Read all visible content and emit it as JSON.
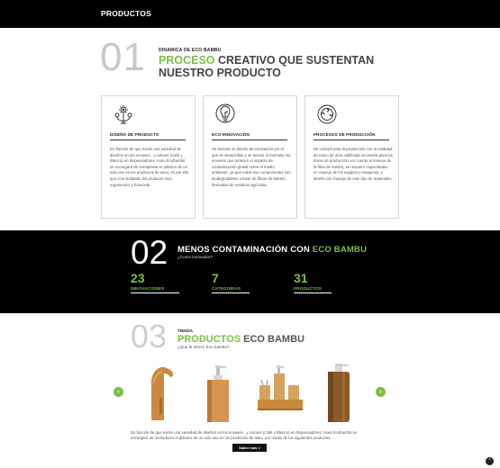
{
  "header": {
    "title": "PRODUCTOS"
  },
  "section1": {
    "number": "01",
    "eyebrow": "DINAMICA DE ECO BAMBU",
    "heading_green": "PROCESO",
    "heading_rest": " CREATIVO QUE SUSTENTAN NUESTRO PRODUCTO",
    "cards": [
      {
        "icon": "gear-tree-icon",
        "title": "DISEÑO DE PRODUCTO",
        "body": "En función de que existe una variedad de diseños en los envases , y colores (Café y Blanco) en dispensadores, Aseo Ecobambú se encargará de reemplazar el plástico de un solo uso en los productos de aseo, es por ello que el prototipado del producto sera ergonomico y funcional."
      },
      {
        "icon": "lightbulb-leaf-icon",
        "title": "ECO-INNOVACIÓN",
        "body": "Se lanzará un diseño de innovación por el que se desarrollan y se lanzan al mercado los envases que reducen el impacto de contaminación global sobre el medio ambiente, ya que todos sus componentes son biodegradables a base de fibras de bambú, derivados de residuos agrícolas."
      },
      {
        "icon": "recycle-icon",
        "title": "PROCESOS DE PRODUCCIÓN",
        "body": "Se contará para la producción con la cantidad de mano de obra calificada necesaria para las áreas de producción, en cuanto al manejo de la fibra de bambú, se requiere capacidades en manejo de los equipos y máquinas, y diseño con manejo de este tipo de materiales."
      }
    ]
  },
  "section2": {
    "number": "02",
    "title_rest": "MENOS CONTAMINACIÓN CON ",
    "title_green": "ECO BAMBU",
    "subtitle": "¿Como innovador?",
    "stats": [
      {
        "value": "23",
        "label": "INNOVACIONES"
      },
      {
        "value": "7",
        "label": "CATEGORIAS"
      },
      {
        "value": "31",
        "label": "PRODUCTOS"
      }
    ]
  },
  "section3": {
    "number": "03",
    "eyebrow": "TIENDA",
    "title_green": "PRODUCTOS",
    "title_rest": " ECO BAMBU",
    "subtitle": "¿Que le ofrece Eco bambu?",
    "products": [
      "curved-soap-dispenser",
      "square-bamboo-pump-dispenser",
      "bamboo-bath-set",
      "cylinder-bamboo-dispenser"
    ],
    "description": "En función de que existe una variedad de diseños en los envases , y colores (Café y Blanco) en dispensadores, Aseo Ecobambú se encargará de reemplazar el plástico de un solo uso en los productos de aseo, por medio de los siguientes productos.",
    "button_label": "Saber más >",
    "prev_label": "‹",
    "next_label": "›"
  },
  "scroll_top_label": "^",
  "colors": {
    "accent": "#7ac043",
    "dark": "#000000",
    "bamboo": "#c98a3e"
  }
}
